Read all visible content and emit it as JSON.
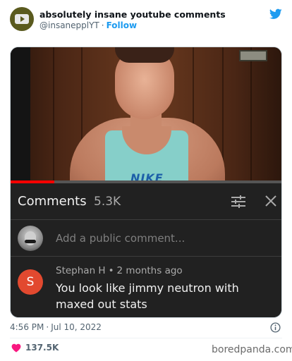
{
  "tweet": {
    "account_name": "absolutely insane youtube comments",
    "handle": "@insanepplYT",
    "separator": "·",
    "follow_label": "Follow",
    "time": "4:56 PM",
    "date": "Jul 10, 2022",
    "likes": "137.5K"
  },
  "video": {
    "shirt_logo_text": "NIKE",
    "progress_fraction": 0.16,
    "progress_color": "#ff0000"
  },
  "comments_panel": {
    "title": "Comments",
    "count": "5.3K",
    "add_placeholder": "Add a public comment...",
    "comment": {
      "avatar_letter": "S",
      "author": "Stephan H",
      "separator": "•",
      "age": "2 months ago",
      "text": "You look like jimmy neutron with maxed out stats"
    }
  },
  "icons": {
    "twitter": "twitter-bird-icon",
    "sort": "sort-sliders-icon",
    "close": "close-icon",
    "info": "info-icon",
    "heart": "heart-icon"
  },
  "colors": {
    "twitter_blue": "#1d9bf0",
    "heart_pink": "#f91880",
    "comment_avatar": "#e2492f",
    "panel_bg": "#212121"
  },
  "watermark": "boredpanda.com"
}
